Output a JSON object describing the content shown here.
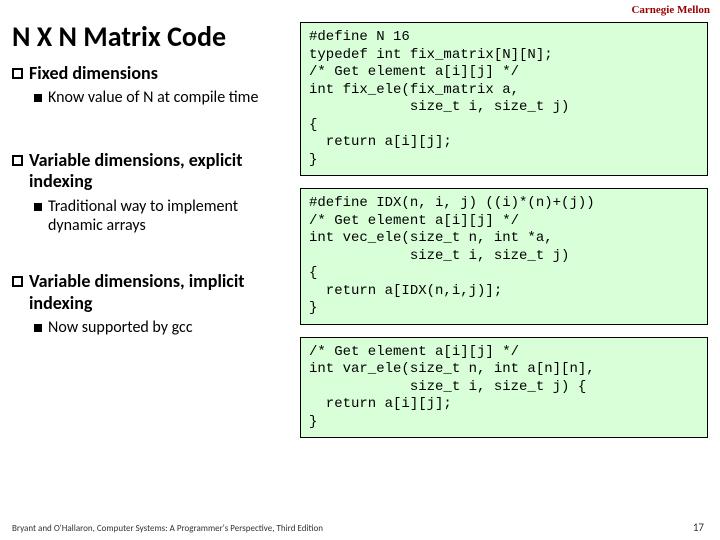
{
  "header": {
    "org": "Carnegie Mellon"
  },
  "title": "N X N Matrix Code",
  "bullets": [
    {
      "label": "Fixed dimensions",
      "sub": [
        "Know value of N at compile time"
      ]
    },
    {
      "label": "Variable dimensions, explicit indexing",
      "sub": [
        "Traditional way to implement dynamic arrays"
      ]
    },
    {
      "label": "Variable dimensions, implicit indexing",
      "sub": [
        "Now supported by gcc"
      ]
    }
  ],
  "code": {
    "box1": "#define N 16\ntypedef int fix_matrix[N][N];\n/* Get element a[i][j] */\nint fix_ele(fix_matrix a,\n            size_t i, size_t j)\n{\n  return a[i][j];\n}",
    "box2": "#define IDX(n, i, j) ((i)*(n)+(j))\n/* Get element a[i][j] */\nint vec_ele(size_t n, int *a,\n            size_t i, size_t j)\n{\n  return a[IDX(n,i,j)];\n}",
    "box3": "/* Get element a[i][j] */\nint var_ele(size_t n, int a[n][n],\n            size_t i, size_t j) {\n  return a[i][j];\n}"
  },
  "footer": {
    "left": "Bryant and O'Hallaron, Computer Systems: A Programmer's Perspective, Third Edition",
    "page": "17"
  }
}
